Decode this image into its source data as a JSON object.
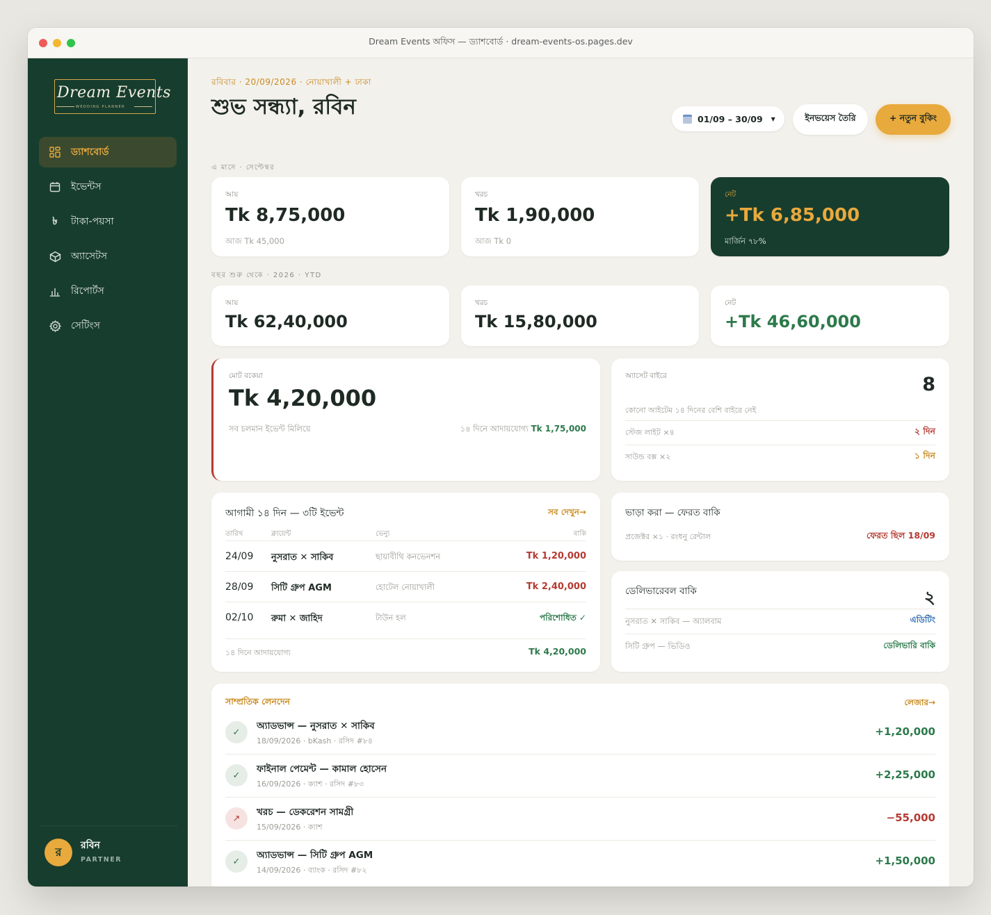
{
  "window": {
    "title": "Dream Events অফিস — ড্যাশবোর্ড · dream-events-os.pages.dev"
  },
  "brand": {
    "logo_text": "Dream Events",
    "logo_sub": "WEDDING PLANNER"
  },
  "sidebar": {
    "items": [
      {
        "label": "ড্যাশবোর্ড",
        "icon": "grid-icon",
        "active": true
      },
      {
        "label": "ইভেন্টস",
        "icon": "calendar-icon"
      },
      {
        "label": "টাকা-পয়সা",
        "icon": "taka-icon",
        "glyph": "৳"
      },
      {
        "label": "অ্যাসেটস",
        "icon": "box-icon"
      },
      {
        "label": "রিপোর্টস",
        "icon": "bar-chart-icon"
      },
      {
        "label": "সেটিংস",
        "icon": "gear-icon"
      }
    ],
    "user": {
      "initial": "র",
      "name": "রবিন",
      "role": "PARTNER"
    }
  },
  "header": {
    "eyebrow": "রবিবার · 20/09/2026 · নোয়াখালী + ঢাকা",
    "greeting": "শুভ সন্ধ্যা, রবিন",
    "date_range": "01/09 – 30/09",
    "invoice_label": "ইনভয়েস তৈরি",
    "new_booking_label": "+ নতুন বুকিং"
  },
  "month": {
    "label": "এ মাসে · সেপ্টেম্বর",
    "income": {
      "label": "আয়",
      "value": "Tk 8,75,000",
      "sub": "আজ Tk 45,000"
    },
    "expense": {
      "label": "খরচ",
      "value": "Tk 1,90,000",
      "sub": "আজ Tk 0"
    },
    "net": {
      "label": "নেট",
      "value": "+Tk 6,85,000",
      "sub": "মার্জিন ৭৮%"
    }
  },
  "ytd": {
    "label": "বছর শুরু থেকে · 2026 · YTD",
    "income": {
      "label": "আয়",
      "value": "Tk 62,40,000"
    },
    "expense": {
      "label": "খরচ",
      "value": "Tk 15,80,000"
    },
    "net": {
      "label": "নেট",
      "value": "+Tk 46,60,000"
    }
  },
  "outstanding": {
    "label": "মোট বকেয়া",
    "value": "Tk 4,20,000",
    "sub": "সব চলমান ইভেন্ট মিলিয়ে",
    "due_note": "১৪ দিনে আদায়যোগ্য",
    "due_amount": "Tk 1,75,000"
  },
  "assets_out": {
    "label": "অ্যাসেট বাইরে",
    "count": "8",
    "note": "কোনো আইটেম ১৪ দিনের বেশি বাইরে নেই",
    "items": [
      {
        "name": "স্টেজ লাইট ×৪",
        "days": "২ দিন"
      },
      {
        "name": "সাউন্ড বক্স ×২",
        "days": "১ দিন"
      }
    ]
  },
  "events": {
    "title": "আগামী ১৪ দিন — ৩টি ইভেন্ট",
    "see_all": "সব দেখুন→",
    "columns": [
      "তারিখ",
      "ক্লায়েন্ট",
      "ভেন্যু",
      "বাকি"
    ],
    "rows": [
      {
        "date": "24/09",
        "client": "নুসরাত ✕ সাকিব",
        "venue": "ছায়াবীথি কনভেনশন",
        "due": "Tk 1,20,000",
        "status": "due"
      },
      {
        "date": "28/09",
        "client": "সিটি গ্রুপ AGM",
        "venue": "হোটেল নোয়াখালী",
        "due": "Tk 2,40,000",
        "status": "due"
      },
      {
        "date": "02/10",
        "client": "রুমা ✕ জাহিদ",
        "venue": "টাউন হল",
        "due": "পরিশোধিত ✓",
        "status": "paid"
      }
    ],
    "footer_label": "১৪ দিনে আদায়যোগ্য",
    "footer_amount": "Tk 4,20,000"
  },
  "rentals": {
    "title": "ভাড়া করা — ফেরত বাকি",
    "item": "প্রজেক্টর ×১ · রংধনু রেন্টাল",
    "status": "ফেরত ছিল 18/09"
  },
  "deliverables": {
    "title": "ডেলিভারেবল বাকি",
    "count": "২",
    "items": [
      {
        "name": "নুসরাত ✕ সাকিব — অ্যালবাম",
        "status": "এডিটিং"
      },
      {
        "name": "সিটি গ্রুপ — ভিডিও",
        "status": "ডেলিভারি বাকি"
      }
    ]
  },
  "transactions": {
    "title": "সাম্প্রতিক লেনদেন",
    "ledger_link": "লেজার→",
    "rows": [
      {
        "title": "অ্যাডভান্স — নুসরাত ✕ সাকিব",
        "meta": "18/09/2026 · bKash · রসিদ #৮৪",
        "amount": "+1,20,000",
        "type": "in",
        "icon": "✓"
      },
      {
        "title": "ফাইনাল পেমেন্ট — কামাল হোসেন",
        "meta": "16/09/2026 · ক্যাশ · রসিদ #৮৩",
        "amount": "+2,25,000",
        "type": "in",
        "icon": "✓"
      },
      {
        "title": "খরচ — ডেকরেশন সামগ্রী",
        "meta": "15/09/2026 · ক্যাশ",
        "amount": "−55,000",
        "type": "out",
        "icon": "↗"
      },
      {
        "title": "অ্যাডভান্স — সিটি গ্রুপ AGM",
        "meta": "14/09/2026 · ব্যাংক · রসিদ #৮২",
        "amount": "+1,50,000",
        "type": "in",
        "icon": "✓"
      }
    ]
  },
  "colors": {
    "sidebar": "#173d2e",
    "accent": "#e8a93d",
    "positive": "#2c7a4b",
    "negative": "#b53a32"
  }
}
